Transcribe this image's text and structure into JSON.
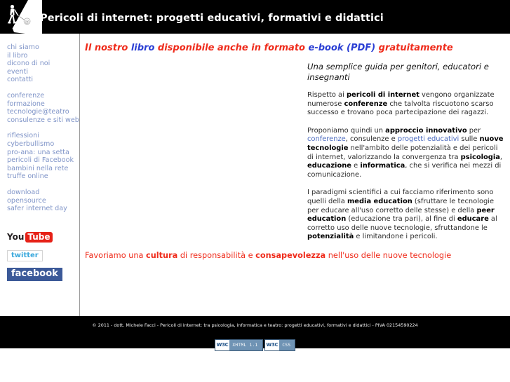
{
  "header": {
    "site_title": "Pericoli di internet: progetti educativi, formativi e didattici",
    "logo_alt": "walking-man-at-symbol-logo"
  },
  "sidebar": {
    "groups": [
      {
        "items": [
          {
            "label": "chi siamo"
          },
          {
            "label": "il libro"
          },
          {
            "label": "dicono di noi"
          },
          {
            "label": "eventi"
          },
          {
            "label": "contatti"
          }
        ]
      },
      {
        "items": [
          {
            "label": "conferenze"
          },
          {
            "label": "formazione"
          },
          {
            "label": "tecnologie@teatro"
          },
          {
            "label": "consulenze e siti web"
          }
        ]
      },
      {
        "items": [
          {
            "label": "riflessioni"
          },
          {
            "label": "cyberbullismo"
          },
          {
            "label": "pro-ana: una setta"
          },
          {
            "label": "pericoli di Facebook"
          },
          {
            "label": "bambini nella rete"
          },
          {
            "label": "truffe online"
          }
        ]
      },
      {
        "items": [
          {
            "label": "download"
          },
          {
            "label": "opensource"
          },
          {
            "label": "safer internet day"
          }
        ]
      }
    ],
    "social": {
      "youtube": {
        "word1": "You",
        "word2": "Tube"
      },
      "twitter": {
        "label": "twitter"
      },
      "facebook": {
        "label": "facebook"
      }
    }
  },
  "main": {
    "headline_parts": [
      {
        "text": "Il nostro ",
        "color": "red"
      },
      {
        "text": "libro ",
        "color": "blue"
      },
      {
        "text": "disponibile anche in formato ",
        "color": "red"
      },
      {
        "text": "e-book (PDF) ",
        "color": "blue"
      },
      {
        "text": "gratuitamente",
        "color": "red"
      }
    ],
    "article": {
      "heading": "Una semplice guida per genitori, educatori e insegnanti",
      "paragraph_1": {
        "t1": "Rispetto ai ",
        "b1": "pericoli di internet",
        "t2": " vengono organizzate numerose ",
        "b2": "conferenze",
        "t3": " che talvolta riscuotono scarso successo e trovano poca partecipazione dei ragazzi."
      },
      "paragraph_2": {
        "t1": "Proponiamo quindi un ",
        "b1": "approccio innovativo",
        "t2": " per ",
        "l1": "conferenze",
        "t3": ", consulenze e ",
        "l2": "progetti educativi",
        "t4": " sulle ",
        "b2": "nuove tecnologie",
        "t5": " nell'ambito delle potenzialità e dei pericoli di internet, valorizzando la convergenza tra ",
        "b3": "psicologia",
        "t6": ", ",
        "b4": "educazione",
        "t7": " e ",
        "b5": "informatica",
        "t8": ", che si verifica nei mezzi di comunicazione."
      },
      "paragraph_3": {
        "t1": "I paradigmi scientifici a cui facciamo riferimento sono quelli della ",
        "b1": "media education",
        "t2": " (sfruttare le tecnologie per educare all'uso corretto delle stesse) e della ",
        "b2": "peer education",
        "t3": " (educazione tra pari), al fine di ",
        "b3": "educare",
        "t4": " al corretto uso delle nuove tecnologie, sfruttandone le ",
        "b4": "potenzialità",
        "t5": " e limitandone i pericoli."
      }
    },
    "tagline": {
      "t1": "Favoriamo una ",
      "b1": "cultura",
      "t2": " di responsabilità e ",
      "b2": "consapevolezza",
      "t3": " nell'uso delle nuove tecnologie"
    }
  },
  "footer": {
    "copyright": "© 2011 - dott. Michele Facci - Pericoli di internet: tra psicologia, informatica e teatro: progetti educativi, formativi e didattici - PIVA 02154590224",
    "validators": [
      {
        "mark": "W3C",
        "label": "XHTML 1.1"
      },
      {
        "mark": "W3C",
        "label": "CSS"
      }
    ]
  },
  "colors": {
    "accent_red": "#ef2b1b",
    "accent_blue": "#2b3fd4",
    "nav_link": "#8095c8",
    "link_blue": "#4c6bbf",
    "header_bg": "#000000"
  }
}
